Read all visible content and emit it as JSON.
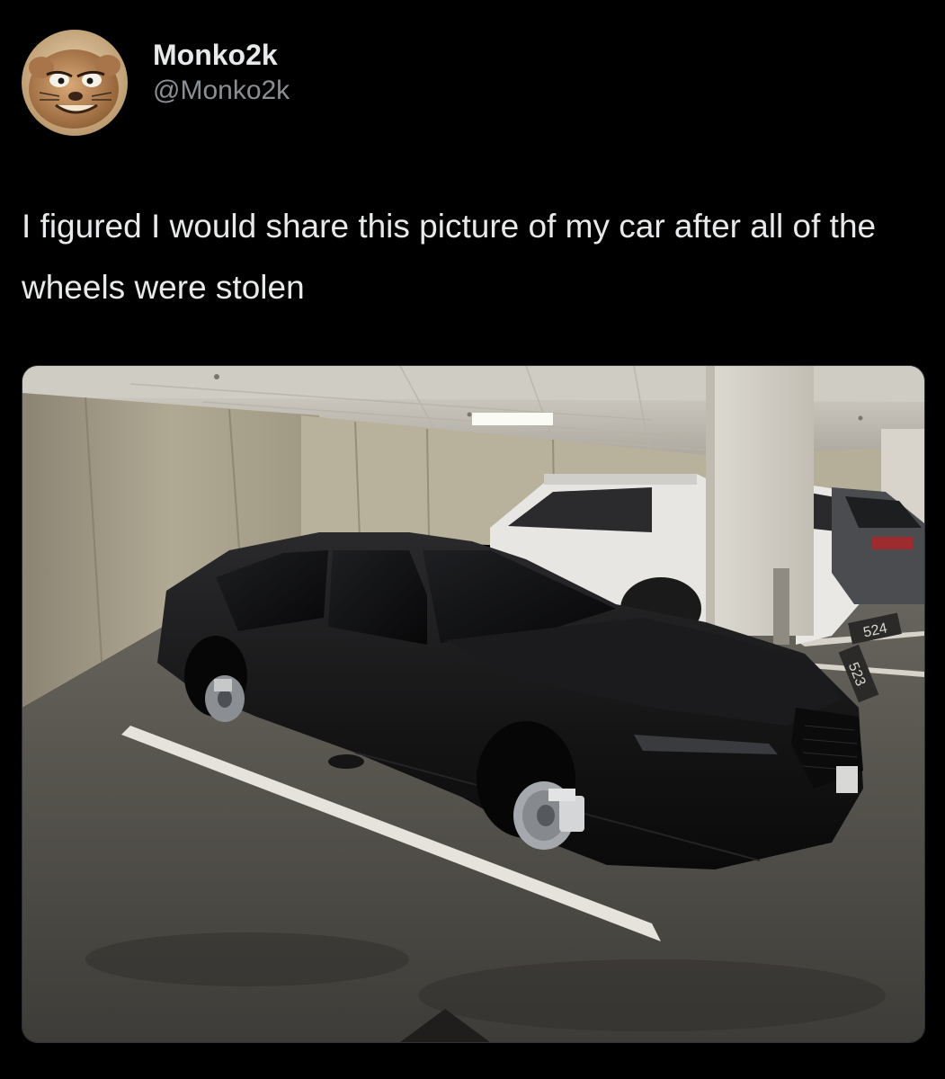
{
  "author": {
    "display_name": "Monko2k",
    "handle": "@Monko2k",
    "avatar_icon": "cartoon-face-avatar"
  },
  "tweet": {
    "text": "I figured I would share this picture of my car after all of the wheels were stolen"
  },
  "media": {
    "kind": "photo",
    "icon": "parked-car-missing-wheels-photo",
    "parking_space_labels": [
      "524",
      "523"
    ]
  },
  "colors": {
    "background": "#000000",
    "text_primary": "#e7e9ea",
    "text_secondary": "#8b8f94"
  }
}
